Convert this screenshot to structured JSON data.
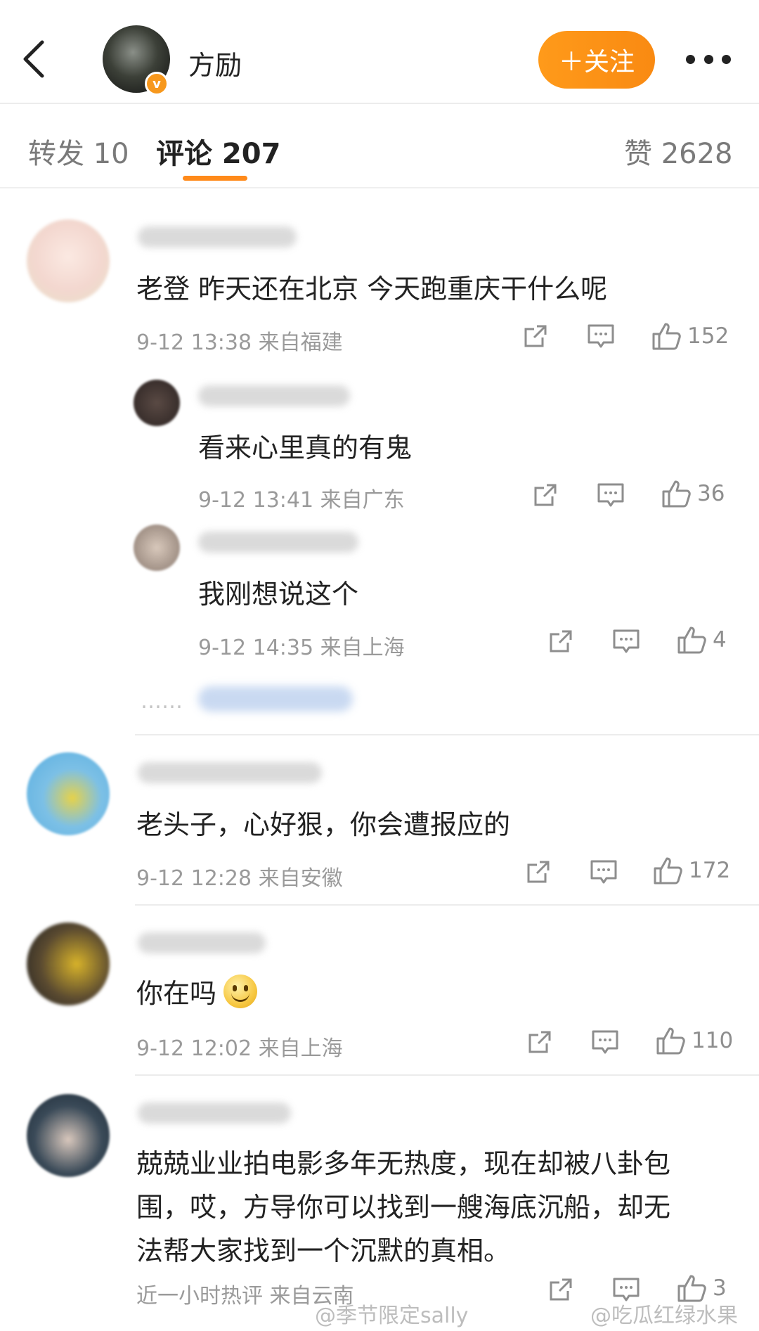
{
  "header": {
    "username": "方励",
    "verified_badge": "v",
    "follow_label": "＋关注",
    "back_icon": "chevron-left-icon",
    "more_icon": "more-dots-icon"
  },
  "tabs": {
    "repost": "转发 10",
    "comments": "评论 207",
    "likes": "赞 2628"
  },
  "comments": [
    {
      "text": "老登 昨天还在北京 今天跑重庆干什么呢",
      "meta": "9-12 13:38 来自福建",
      "likes": "152"
    },
    {
      "text": "看来心里真的有鬼",
      "meta": "9-12 13:41 来自广东",
      "likes": "36"
    },
    {
      "text": "我刚想说这个",
      "meta": "9-12 14:35 来自上海",
      "likes": "4"
    },
    {
      "text": "老头子，心好狠，你会遭报应的",
      "meta": "9-12 12:28 来自安徽",
      "likes": "172"
    },
    {
      "text": "你在吗",
      "meta": "9-12 12:02 来自上海",
      "likes": "110"
    },
    {
      "text_lines": [
        "兢兢业业拍电影多年无热度，现在却被八卦包",
        "围，哎，方导你可以找到一艘海底沉船，却无",
        "法帮大家找到一个沉默的真相。"
      ],
      "meta": "近一小时热评 来自云南",
      "likes": "3"
    }
  ],
  "more_replies_dots": "……",
  "watermarks": {
    "left": "@季节限定sally",
    "right": "@吃瓜红绿水果"
  },
  "colors": {
    "accent": "#ff8a1a",
    "text": "#222222",
    "meta": "#9a9a9a"
  }
}
